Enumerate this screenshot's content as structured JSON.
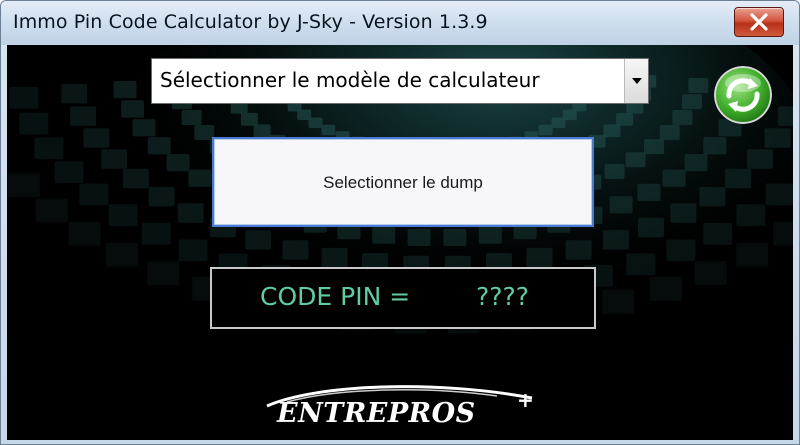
{
  "window": {
    "title": "Immo Pin Code Calculator by J-Sky  -  Version 1.3.9"
  },
  "model_select": {
    "selected": "Sélectionner le modèle de calculateur"
  },
  "dump_button": {
    "label": "Selectionner le dump"
  },
  "pin_display": {
    "label": "CODE PIN =",
    "value": "????"
  },
  "logo": {
    "text": "ENTREPROS",
    "plus": "+"
  },
  "icons": {
    "close": "close-icon",
    "dropdown": "chevron-down-icon",
    "refresh": "refresh-icon"
  },
  "colors": {
    "pin_text": "#5fcda0",
    "client_bg": "#000000",
    "close_button": "#c4472d",
    "refresh_green": "#3fae2a",
    "dump_border": "#4a7bd0"
  }
}
